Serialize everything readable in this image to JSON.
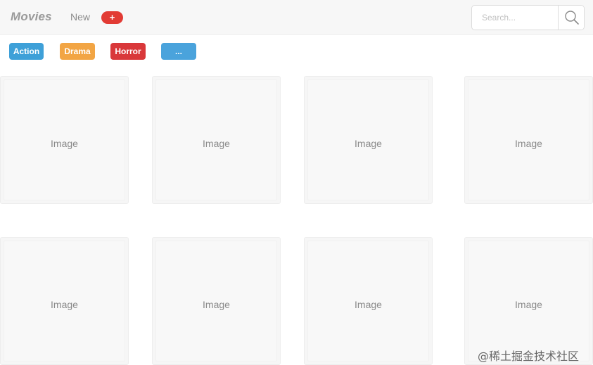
{
  "header": {
    "brand": "Movies",
    "nav_new": "New",
    "add_label": "+",
    "search": {
      "placeholder": "Search...",
      "value": ""
    }
  },
  "genres": [
    {
      "label": "Action",
      "color": "#3ea0d8"
    },
    {
      "label": "Drama",
      "color": "#f2a544"
    },
    {
      "label": "Horror",
      "color": "#d9383a"
    },
    {
      "label": "...",
      "color": "#4aa3dc"
    }
  ],
  "cards": [
    {
      "label": "Image"
    },
    {
      "label": "Image"
    },
    {
      "label": "Image"
    },
    {
      "label": "Image"
    },
    {
      "label": "Image"
    },
    {
      "label": "Image"
    },
    {
      "label": "Image"
    },
    {
      "label": "Image"
    }
  ],
  "watermark": "@稀土掘金技术社区",
  "colors": {
    "header_bg": "#f7f7f7",
    "add_button": "#e23b34",
    "card_bg": "#f6f6f6"
  },
  "icons": {
    "search": "search-icon"
  }
}
